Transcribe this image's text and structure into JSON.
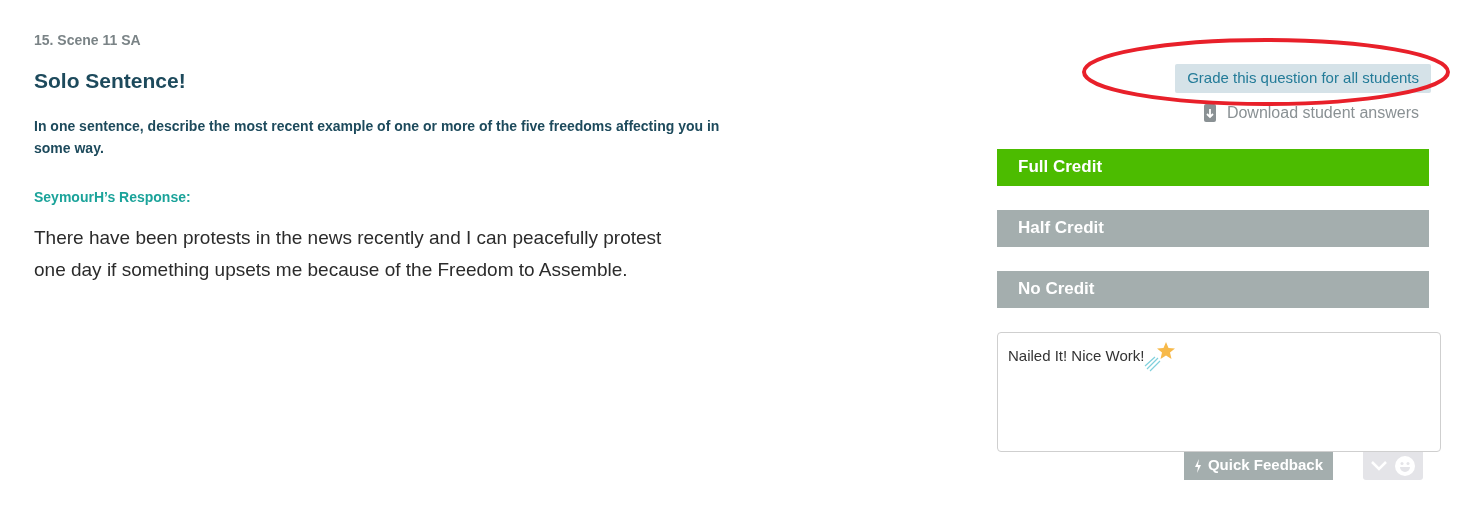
{
  "question": {
    "number": "15. Scene 11 SA",
    "title": "Solo Sentence!",
    "prompt": "In one sentence, describe the most recent example of one or more of the five freedoms affecting you in some way."
  },
  "response": {
    "label": "SeymourH’s Response:",
    "text": "There have been protests in the news recently and I can peacefully protest one day if something upsets me because of the Freedom to Assemble."
  },
  "grade_all_button": {
    "label": "Grade this question for all students",
    "circled": true
  },
  "download_link": {
    "label": "Download student answers"
  },
  "credit_buttons": [
    {
      "label": "Full Credit",
      "selected": true
    },
    {
      "label": "Half Credit",
      "selected": false
    },
    {
      "label": "No Credit",
      "selected": false
    }
  ],
  "feedback": {
    "value": "Nailed It! Nice Work!"
  },
  "quick_feedback_button": {
    "label": "Quick Feedback"
  }
}
